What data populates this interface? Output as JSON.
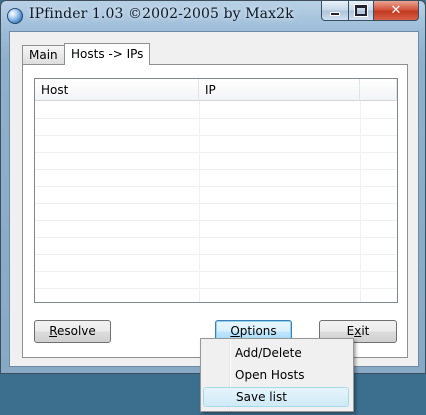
{
  "window": {
    "title": "IPfinder 1.03 ©2002-2005 by Max2k"
  },
  "tabs": [
    {
      "label": "Main",
      "active": false
    },
    {
      "label": "Hosts -> IPs",
      "active": true
    }
  ],
  "list": {
    "columns": [
      "Host",
      "IP",
      ""
    ],
    "rows": []
  },
  "buttons": {
    "resolve": {
      "mnemonic": "R",
      "rest": "esolve"
    },
    "options": {
      "mnemonic": "O",
      "rest": "ptions"
    },
    "exit": {
      "before": "E",
      "mnemonic": "x",
      "after": "it"
    }
  },
  "menu": {
    "items": [
      {
        "label": "Add/Delete",
        "highlighted": false
      },
      {
        "label": "Open Hosts",
        "highlighted": false
      },
      {
        "label": "Save list",
        "highlighted": true
      }
    ]
  },
  "colors": {
    "desktop": "#3c6f8e",
    "close_button": "#c0391f",
    "focus_button": "#3c7fb1",
    "menu_highlight": "#cfeaf7"
  }
}
